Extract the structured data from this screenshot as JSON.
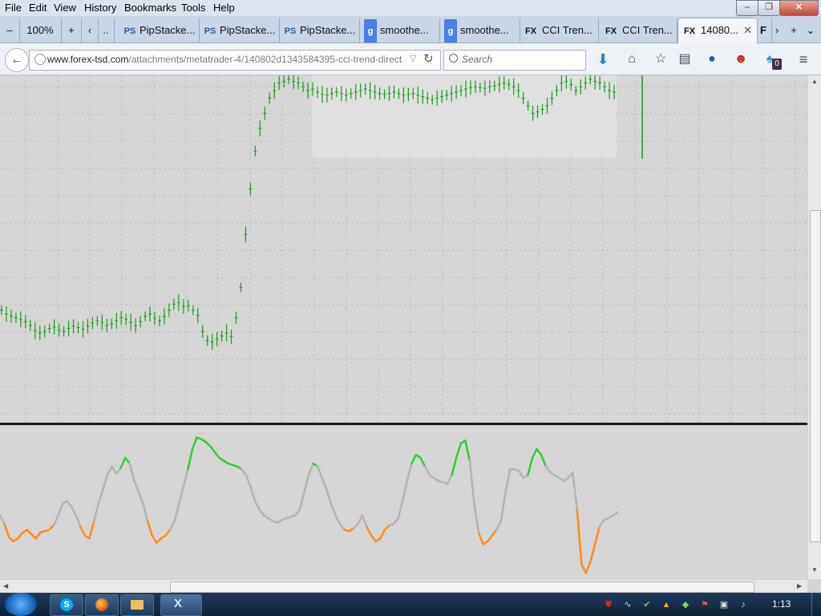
{
  "menubar": {
    "items": [
      "File",
      "Edit",
      "View",
      "History",
      "Bookmarks",
      "Tools",
      "Help"
    ]
  },
  "window_controls": {
    "minimize": "–",
    "restore": "❐",
    "close": "✕"
  },
  "tabstrip": {
    "zoom": "100%",
    "tabs": [
      {
        "label": "PipStacke...",
        "favicon": "PS"
      },
      {
        "label": "PipStacke...",
        "favicon": "PS"
      },
      {
        "label": "PipStacke...",
        "favicon": "PS"
      },
      {
        "label": "smoothe...",
        "favicon": "g"
      },
      {
        "label": "smoothe...",
        "favicon": "g"
      },
      {
        "label": "CCI Tren...",
        "favicon": "FX"
      },
      {
        "label": "CCI Tren...",
        "favicon": "FX"
      },
      {
        "label": "14080...",
        "favicon": "FX",
        "active": true
      }
    ],
    "overflow_favicon": "F"
  },
  "navbar": {
    "url_domain": "www.forex-tsd.com",
    "url_path": "/attachments/metatrader-4/140802d1343584395-cci-trend-direct",
    "search_placeholder": "Search",
    "notification_count": "0"
  },
  "taskbar": {
    "clock": "1:13"
  },
  "colors": {
    "bar_green": "#1a9a1a",
    "osc_up": "#33cc33",
    "osc_down": "#ff8c1a",
    "osc_neutral": "#b4b4b4",
    "chart_bg": "#d6d6d6",
    "grid": "#bdbdbd"
  },
  "chart_data": [
    {
      "type": "bar",
      "title": "",
      "series": [
        {
          "values": [
            1.0,
            0.95,
            0.92,
            0.9,
            0.88,
            0.85,
            0.8,
            0.73,
            0.7,
            0.72,
            0.76,
            0.78,
            0.74,
            0.72,
            0.76,
            0.79,
            0.77,
            0.75,
            0.79,
            0.83,
            0.86,
            0.84,
            0.8,
            0.82,
            0.86,
            0.9,
            0.88,
            0.84,
            0.8,
            0.85,
            0.92,
            0.95,
            0.89,
            0.86,
            0.92,
            1.0,
            1.08,
            1.1,
            1.05,
            1.06,
            1.0,
            0.93,
            0.72,
            0.6,
            0.58,
            0.62,
            0.66,
            0.7,
            0.65,
            0.9,
            1.3,
            2.0,
            2.6,
            3.1,
            3.4,
            3.6,
            3.8,
            3.9,
            4.0,
            4.02,
            4.05,
            4.02,
            4.0,
            3.95,
            3.9,
            3.92,
            3.88,
            3.85,
            3.84,
            3.86,
            3.88,
            3.86,
            3.84,
            3.86,
            3.88,
            3.9,
            3.92,
            3.9,
            3.88,
            3.86,
            3.85,
            3.86,
            3.88,
            3.86,
            3.84,
            3.85,
            3.86,
            3.84,
            3.82,
            3.8,
            3.78,
            3.8,
            3.82,
            3.84,
            3.86,
            3.88,
            3.9,
            3.92,
            3.94,
            3.95,
            3.94,
            3.93,
            3.95,
            3.96,
            3.98,
            4.0,
            3.98,
            3.95,
            3.9,
            3.8,
            3.7,
            3.6,
            3.62,
            3.65,
            3.7,
            3.8,
            3.9,
            4.0,
            4.02,
            3.98,
            3.9,
            3.95,
            4.0,
            4.05,
            4.02,
            4.0,
            3.95,
            3.9,
            3.88
          ]
        }
      ]
    },
    {
      "type": "line",
      "title": "",
      "series": [
        {
          "values": [
            -60,
            -90,
            -135,
            -150,
            -140,
            -120,
            -110,
            -125,
            -140,
            -120,
            -115,
            -110,
            -95,
            -60,
            -20,
            -10,
            -30,
            -60,
            -100,
            -130,
            -140,
            -80,
            -20,
            30,
            80,
            110,
            85,
            105,
            140,
            120,
            60,
            20,
            -20,
            -80,
            -130,
            -155,
            -140,
            -130,
            -110,
            -80,
            -20,
            40,
            100,
            170,
            210,
            205,
            195,
            180,
            160,
            140,
            130,
            120,
            115,
            110,
            100,
            80,
            40,
            -10,
            -40,
            -60,
            -70,
            -80,
            -85,
            -75,
            -70,
            -65,
            -60,
            -40,
            20,
            80,
            120,
            110,
            70,
            30,
            -20,
            -60,
            -90,
            -110,
            -115,
            -105,
            -90,
            -60,
            -100,
            -130,
            -150,
            -140,
            -110,
            -95,
            -90,
            -70,
            -10,
            60,
            120,
            150,
            140,
            110,
            80,
            70,
            60,
            55,
            50,
            80,
            140,
            190,
            200,
            130,
            -20,
            -120,
            -160,
            -150,
            -130,
            -110,
            -80,
            20,
            100,
            100,
            95,
            70,
            80,
            140,
            170,
            150,
            110,
            90,
            80,
            70,
            60,
            70,
            90,
            -40,
            -230,
            -260,
            -220,
            -160,
            -100,
            -75,
            -70,
            -60,
            -50
          ]
        }
      ]
    }
  ]
}
